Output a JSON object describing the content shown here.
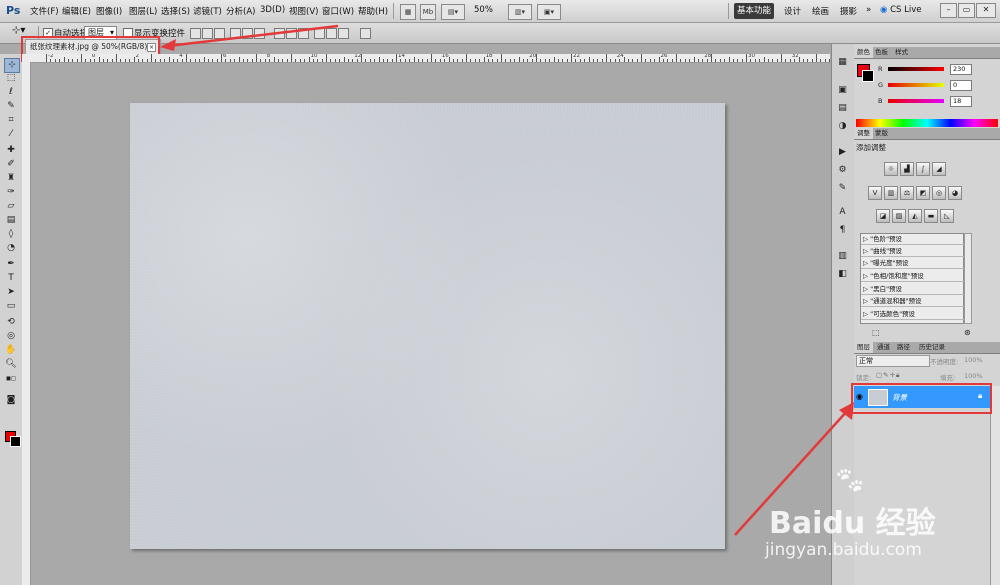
{
  "app": {
    "logo": "Ps",
    "menus": [
      "文件(F)",
      "编辑(E)",
      "图像(I)",
      "图层(L)",
      "选择(S)",
      "滤镜(T)",
      "分析(A)",
      "3D(D)",
      "视图(V)",
      "窗口(W)",
      "帮助(H)"
    ],
    "icon_labels": {
      "mb": "Mb",
      "zoom": "50%"
    },
    "workspace_button": "基本功能",
    "workspace_menus": [
      "设计",
      "绘画",
      "摄影"
    ],
    "more": "»",
    "cs_live": "CS Live"
  },
  "options_bar": {
    "auto_select_label": "自动选择:",
    "auto_select_checked": true,
    "auto_select_value": "图层",
    "show_transform_label": "显示变换控件",
    "show_transform_checked": false
  },
  "document": {
    "tab_title": "纸张纹理素材.jpg @ 50%(RGB/8)",
    "close_glyph": "×",
    "ruler_numbers": [
      "-2",
      "0",
      "2",
      "4",
      "6",
      "8",
      "10",
      "12",
      "14",
      "16",
      "18",
      "20",
      "22",
      "24",
      "26",
      "28",
      "30",
      "32",
      "34"
    ]
  },
  "color_panel": {
    "tabs": [
      "颜色",
      "色板",
      "样式"
    ],
    "channels": [
      {
        "label": "R",
        "value": "230"
      },
      {
        "label": "G",
        "value": "0"
      },
      {
        "label": "B",
        "value": "18"
      }
    ],
    "foreground": "#e60012",
    "background": "#000000"
  },
  "adjustments_panel": {
    "tabs": [
      "调整",
      "蒙版"
    ],
    "heading": "添加调整",
    "presets": [
      "\"色阶\"预设",
      "\"曲线\"预设",
      "\"曝光度\"预设",
      "\"色相/饱和度\"预设",
      "\"黑白\"预设",
      "\"通道混和器\"预设",
      "\"可选颜色\"预设"
    ]
  },
  "layers_panel": {
    "tabs": [
      "图层",
      "通道",
      "路径",
      "历史记录"
    ],
    "blend_mode": "正常",
    "opacity_label": "不透明度:",
    "opacity_value": "100%",
    "lock_label": "锁定:",
    "fill_label": "填充:",
    "fill_value": "100%",
    "layers": [
      {
        "name": "背景",
        "visible": true,
        "locked": true,
        "selected": true
      }
    ]
  },
  "watermark": {
    "brand": "Baidu 经验",
    "url": "jingyan.baidu.com"
  },
  "colors": {
    "accent_red": "#e23a3a",
    "layer_selected": "#3399ff",
    "canvas_texture": "#c8ccd3"
  }
}
